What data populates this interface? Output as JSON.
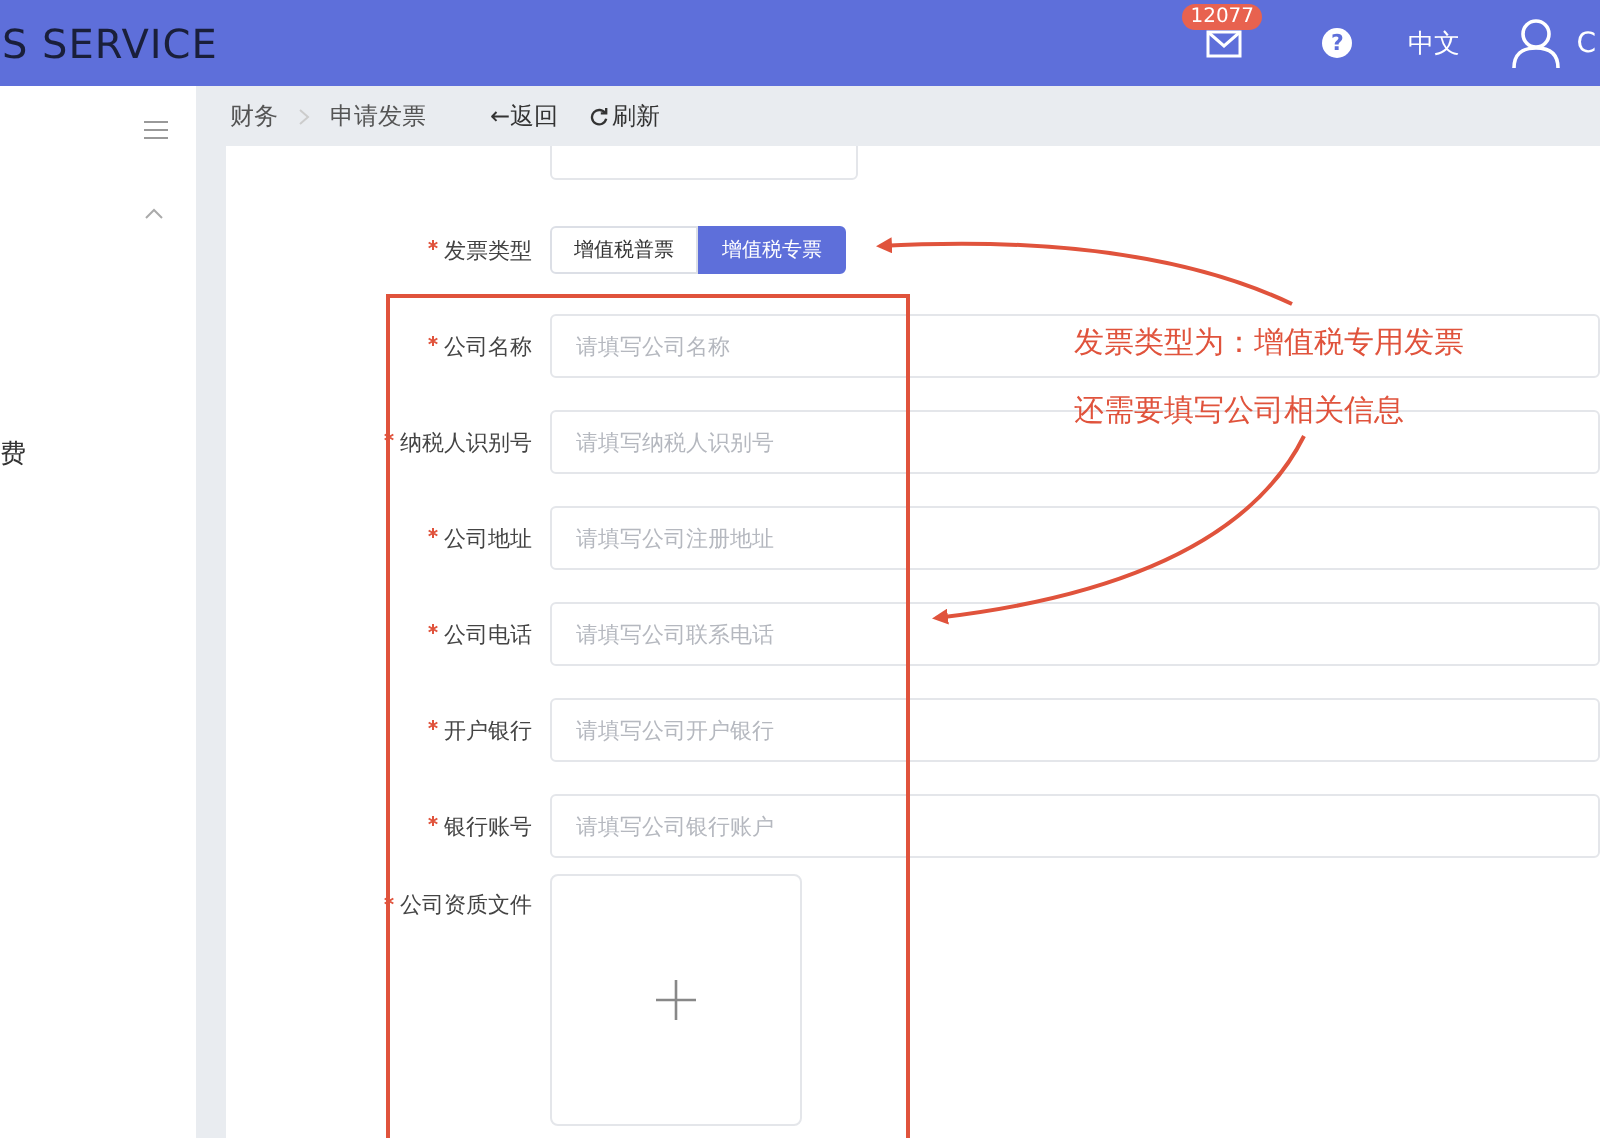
{
  "header": {
    "logo": "S SERVICE",
    "mail_badge": "12077",
    "help": "?",
    "language": "中文",
    "user": "C"
  },
  "sidebar": {
    "items": [
      {
        "label": "费"
      }
    ]
  },
  "breadcrumb": {
    "items": [
      "财务",
      "申请发票"
    ],
    "back": "←返回",
    "refresh": "刷新"
  },
  "form": {
    "invoice_type": {
      "label": "发票类型",
      "required": true,
      "options": [
        {
          "label": "增值税普票",
          "selected": false
        },
        {
          "label": "增值税专票",
          "selected": true
        }
      ]
    },
    "fields": [
      {
        "label": "公司名称",
        "required": true,
        "placeholder": "请填写公司名称"
      },
      {
        "label": "纳税人识别号",
        "required": true,
        "placeholder": "请填写纳税人识别号"
      },
      {
        "label": "公司地址",
        "required": true,
        "placeholder": "请填写公司注册地址"
      },
      {
        "label": "公司电话",
        "required": true,
        "placeholder": "请填写公司联系电话"
      },
      {
        "label": "开户银行",
        "required": true,
        "placeholder": "请填写公司开户银行"
      },
      {
        "label": "银行账号",
        "required": true,
        "placeholder": "请填写公司银行账户"
      }
    ],
    "upload": {
      "label": "公司资质文件",
      "required": true
    }
  },
  "annotation": {
    "lines": [
      "发票类型为：增值税专用发票",
      "还需要填写公司相关信息"
    ]
  }
}
